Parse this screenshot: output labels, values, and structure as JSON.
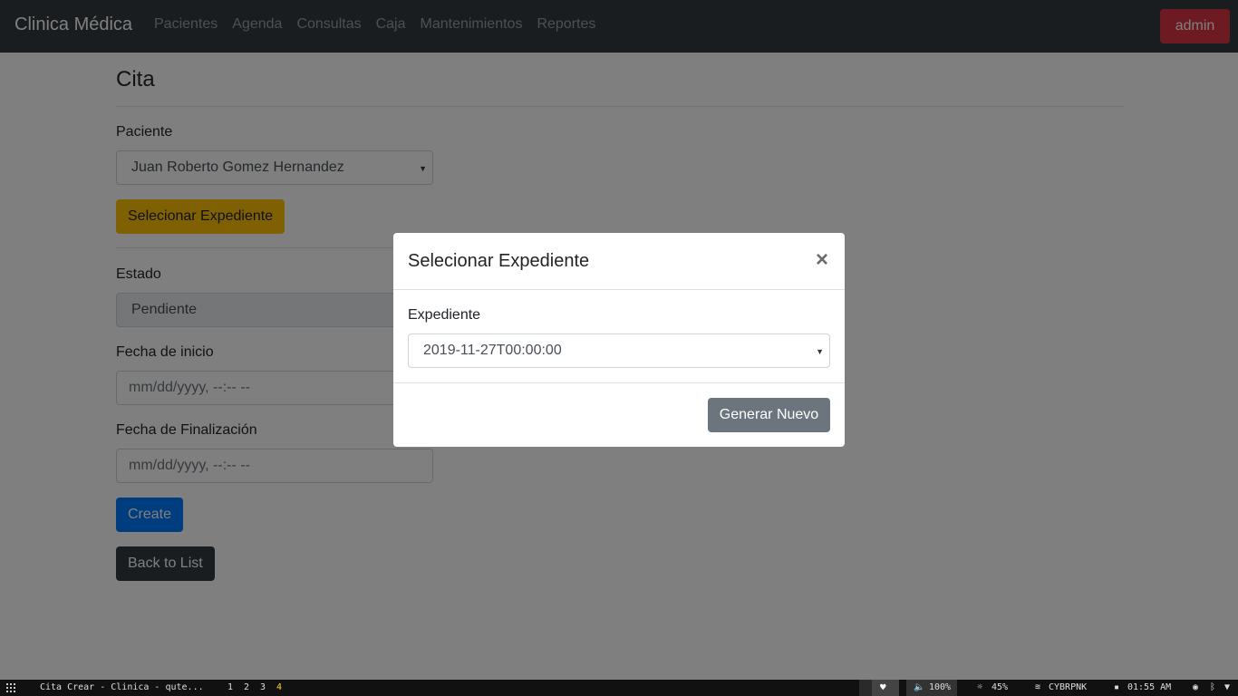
{
  "navbar": {
    "brand": "Clinica Médica",
    "links": [
      "Pacientes",
      "Agenda",
      "Consultas",
      "Caja",
      "Mantenimientos",
      "Reportes"
    ],
    "user_button": "admin"
  },
  "page": {
    "title": "Cita",
    "paciente_label": "Paciente",
    "paciente_value": "Juan Roberto Gomez Hernandez",
    "select_expediente_button": "Selecionar Expediente",
    "estado_label": "Estado",
    "estado_value": "Pendiente",
    "fecha_inicio_label": "Fecha de inicio",
    "fecha_inicio_placeholder": "mm/dd/yyyy, --:-- --",
    "fecha_fin_label": "Fecha de Finalización",
    "fecha_fin_placeholder": "mm/dd/yyyy, --:-- --",
    "create_button": "Create",
    "back_button": "Back to List"
  },
  "modal": {
    "title": "Selecionar Expediente",
    "close_symbol": "×",
    "field_label": "Expediente",
    "field_value": "2019-11-27T00:00:00",
    "generate_button": "Generar Nuevo"
  },
  "taskbar": {
    "window_title": "Cita Crear - Clinica - qute...",
    "workspaces": [
      "1",
      "2",
      "3",
      "4"
    ],
    "active_workspace": "4",
    "volume": "100%",
    "brightness": "45%",
    "network": "CYBRPNK",
    "clock": "01:55 AM"
  },
  "colors": {
    "navbar_bg": "#343a40",
    "danger": "#dc3545",
    "warning": "#ffc107",
    "primary": "#007bff",
    "secondary": "#6c757d",
    "dark": "#343a40"
  }
}
